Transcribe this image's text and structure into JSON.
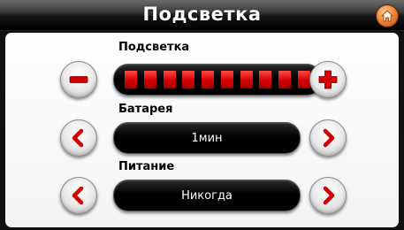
{
  "header": {
    "title": "Подсветка",
    "home_icon": "home-icon"
  },
  "backlight": {
    "label": "Подсветка",
    "level": 10,
    "max_level": 10,
    "accent_color": "#d40000",
    "decrease_icon": "minus-icon",
    "increase_icon": "plus-icon"
  },
  "battery": {
    "label": "Батарея",
    "value": "1мин",
    "prev_icon": "chevron-left-icon",
    "next_icon": "chevron-right-icon"
  },
  "power": {
    "label": "Питание",
    "value": "Никогда",
    "prev_icon": "chevron-left-icon",
    "next_icon": "chevron-right-icon"
  }
}
